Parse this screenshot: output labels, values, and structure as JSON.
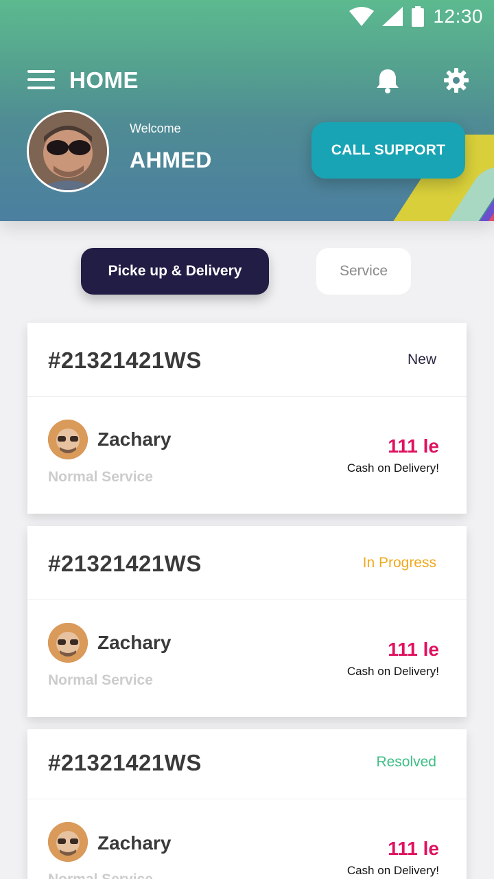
{
  "status_bar": {
    "time": "12:30",
    "icons": [
      "wifi-icon",
      "signal-icon",
      "battery-icon"
    ]
  },
  "header": {
    "title": "HOME",
    "icons": [
      "menu-icon",
      "bell-icon",
      "gear-icon"
    ],
    "welcome_label": "Welcome",
    "user_name": "AHMED",
    "call_support_label": "CALL SUPPORT"
  },
  "tabs": [
    {
      "label": "Picke up & Delivery",
      "active": true
    },
    {
      "label": "Service",
      "active": false
    }
  ],
  "orders": [
    {
      "id": "#21321421WS",
      "status": "New",
      "status_color": "#2a2640",
      "customer": "Zachary",
      "service": "Normal Service",
      "price": "111 le",
      "payment": "Cash on Delivery!"
    },
    {
      "id": "#21321421WS",
      "status": "In Progress",
      "status_color": "#f0a91e",
      "customer": "Zachary",
      "service": "Normal Service",
      "price": "111 le",
      "payment": "Cash on Delivery!"
    },
    {
      "id": "#21321421WS",
      "status": "Resolved",
      "status_color": "#3dbf86",
      "customer": "Zachary",
      "service": "Normal Service",
      "price": "111 le",
      "payment": "Cash on Delivery!"
    }
  ],
  "colors": {
    "accent_dark": "#221d45",
    "support_button": "#18a4b4",
    "price": "#e0115f"
  }
}
